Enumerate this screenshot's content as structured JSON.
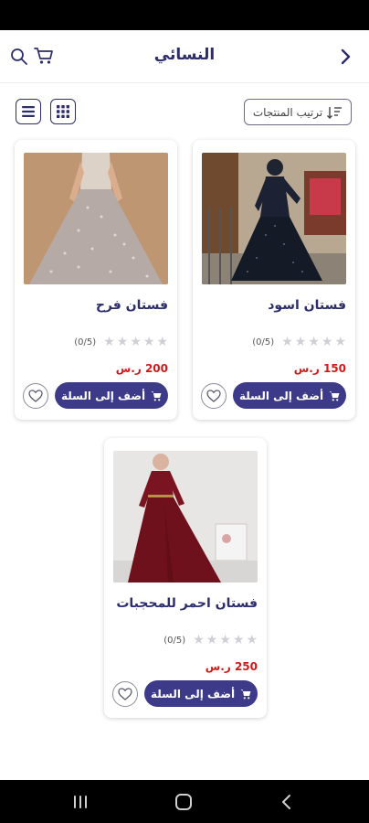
{
  "header": {
    "title": "النسائي"
  },
  "toolbar": {
    "sort_label": "ترتيب المنتجات"
  },
  "products": [
    {
      "name": "فستان اسود",
      "rating_text": "(0/5)",
      "price": "150 ر.س",
      "add_to_cart_label": "أضف إلى السلة"
    },
    {
      "name": "فستان فرح",
      "rating_text": "(0/5)",
      "price": "200 ر.س",
      "add_to_cart_label": "أضف إلى السلة"
    },
    {
      "name": "فستان احمر للمحجبات",
      "rating_text": "(0/5)",
      "price": "250 ر.س",
      "add_to_cart_label": "أضف إلى السلة"
    }
  ],
  "icons": {
    "back": "chevron-right-icon",
    "search": "search-icon",
    "cart": "cart-icon",
    "list_view": "list-view-icon",
    "grid_view": "grid-view-icon",
    "sort": "sort-icon",
    "star": "star-icon",
    "favorite": "heart-icon"
  },
  "colors": {
    "primary": "#3e3a8a",
    "price": "#d01a1a",
    "title": "#2d2d6b",
    "star_empty": "#cfcfd6"
  }
}
